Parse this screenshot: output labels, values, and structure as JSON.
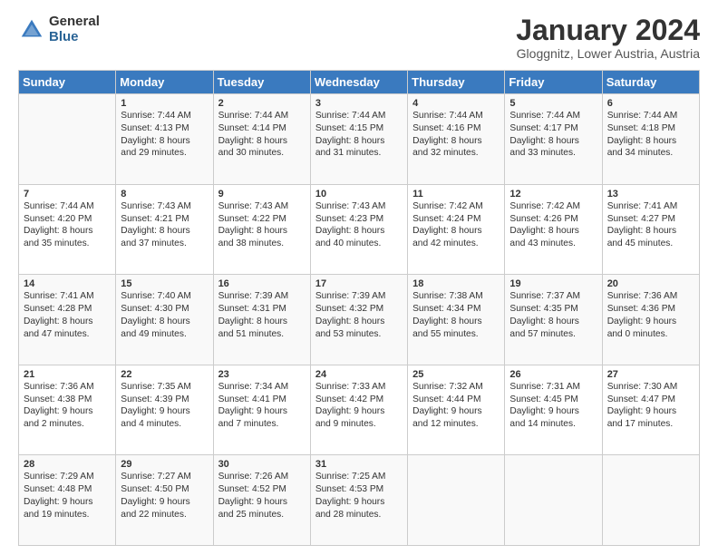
{
  "logo": {
    "general": "General",
    "blue": "Blue"
  },
  "title": "January 2024",
  "subtitle": "Gloggnitz, Lower Austria, Austria",
  "header_days": [
    "Sunday",
    "Monday",
    "Tuesday",
    "Wednesday",
    "Thursday",
    "Friday",
    "Saturday"
  ],
  "weeks": [
    [
      {
        "day": "",
        "content": ""
      },
      {
        "day": "1",
        "content": "Sunrise: 7:44 AM\nSunset: 4:13 PM\nDaylight: 8 hours\nand 29 minutes."
      },
      {
        "day": "2",
        "content": "Sunrise: 7:44 AM\nSunset: 4:14 PM\nDaylight: 8 hours\nand 30 minutes."
      },
      {
        "day": "3",
        "content": "Sunrise: 7:44 AM\nSunset: 4:15 PM\nDaylight: 8 hours\nand 31 minutes."
      },
      {
        "day": "4",
        "content": "Sunrise: 7:44 AM\nSunset: 4:16 PM\nDaylight: 8 hours\nand 32 minutes."
      },
      {
        "day": "5",
        "content": "Sunrise: 7:44 AM\nSunset: 4:17 PM\nDaylight: 8 hours\nand 33 minutes."
      },
      {
        "day": "6",
        "content": "Sunrise: 7:44 AM\nSunset: 4:18 PM\nDaylight: 8 hours\nand 34 minutes."
      }
    ],
    [
      {
        "day": "7",
        "content": "Sunrise: 7:44 AM\nSunset: 4:20 PM\nDaylight: 8 hours\nand 35 minutes."
      },
      {
        "day": "8",
        "content": "Sunrise: 7:43 AM\nSunset: 4:21 PM\nDaylight: 8 hours\nand 37 minutes."
      },
      {
        "day": "9",
        "content": "Sunrise: 7:43 AM\nSunset: 4:22 PM\nDaylight: 8 hours\nand 38 minutes."
      },
      {
        "day": "10",
        "content": "Sunrise: 7:43 AM\nSunset: 4:23 PM\nDaylight: 8 hours\nand 40 minutes."
      },
      {
        "day": "11",
        "content": "Sunrise: 7:42 AM\nSunset: 4:24 PM\nDaylight: 8 hours\nand 42 minutes."
      },
      {
        "day": "12",
        "content": "Sunrise: 7:42 AM\nSunset: 4:26 PM\nDaylight: 8 hours\nand 43 minutes."
      },
      {
        "day": "13",
        "content": "Sunrise: 7:41 AM\nSunset: 4:27 PM\nDaylight: 8 hours\nand 45 minutes."
      }
    ],
    [
      {
        "day": "14",
        "content": "Sunrise: 7:41 AM\nSunset: 4:28 PM\nDaylight: 8 hours\nand 47 minutes."
      },
      {
        "day": "15",
        "content": "Sunrise: 7:40 AM\nSunset: 4:30 PM\nDaylight: 8 hours\nand 49 minutes."
      },
      {
        "day": "16",
        "content": "Sunrise: 7:39 AM\nSunset: 4:31 PM\nDaylight: 8 hours\nand 51 minutes."
      },
      {
        "day": "17",
        "content": "Sunrise: 7:39 AM\nSunset: 4:32 PM\nDaylight: 8 hours\nand 53 minutes."
      },
      {
        "day": "18",
        "content": "Sunrise: 7:38 AM\nSunset: 4:34 PM\nDaylight: 8 hours\nand 55 minutes."
      },
      {
        "day": "19",
        "content": "Sunrise: 7:37 AM\nSunset: 4:35 PM\nDaylight: 8 hours\nand 57 minutes."
      },
      {
        "day": "20",
        "content": "Sunrise: 7:36 AM\nSunset: 4:36 PM\nDaylight: 9 hours\nand 0 minutes."
      }
    ],
    [
      {
        "day": "21",
        "content": "Sunrise: 7:36 AM\nSunset: 4:38 PM\nDaylight: 9 hours\nand 2 minutes."
      },
      {
        "day": "22",
        "content": "Sunrise: 7:35 AM\nSunset: 4:39 PM\nDaylight: 9 hours\nand 4 minutes."
      },
      {
        "day": "23",
        "content": "Sunrise: 7:34 AM\nSunset: 4:41 PM\nDaylight: 9 hours\nand 7 minutes."
      },
      {
        "day": "24",
        "content": "Sunrise: 7:33 AM\nSunset: 4:42 PM\nDaylight: 9 hours\nand 9 minutes."
      },
      {
        "day": "25",
        "content": "Sunrise: 7:32 AM\nSunset: 4:44 PM\nDaylight: 9 hours\nand 12 minutes."
      },
      {
        "day": "26",
        "content": "Sunrise: 7:31 AM\nSunset: 4:45 PM\nDaylight: 9 hours\nand 14 minutes."
      },
      {
        "day": "27",
        "content": "Sunrise: 7:30 AM\nSunset: 4:47 PM\nDaylight: 9 hours\nand 17 minutes."
      }
    ],
    [
      {
        "day": "28",
        "content": "Sunrise: 7:29 AM\nSunset: 4:48 PM\nDaylight: 9 hours\nand 19 minutes."
      },
      {
        "day": "29",
        "content": "Sunrise: 7:27 AM\nSunset: 4:50 PM\nDaylight: 9 hours\nand 22 minutes."
      },
      {
        "day": "30",
        "content": "Sunrise: 7:26 AM\nSunset: 4:52 PM\nDaylight: 9 hours\nand 25 minutes."
      },
      {
        "day": "31",
        "content": "Sunrise: 7:25 AM\nSunset: 4:53 PM\nDaylight: 9 hours\nand 28 minutes."
      },
      {
        "day": "",
        "content": ""
      },
      {
        "day": "",
        "content": ""
      },
      {
        "day": "",
        "content": ""
      }
    ]
  ]
}
